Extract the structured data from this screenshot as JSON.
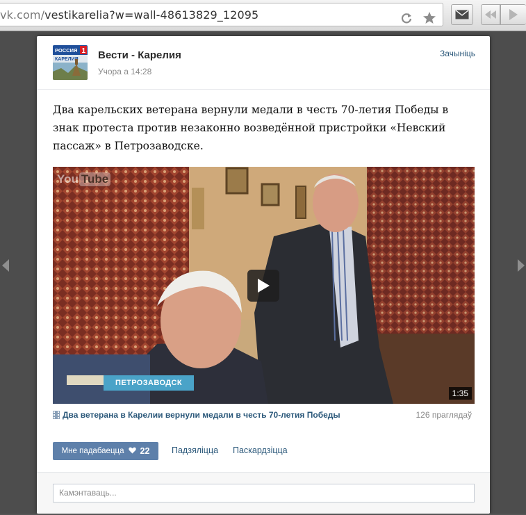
{
  "browser": {
    "url_host": "vk.com/",
    "url_path": "vestikarelia?w=wall-48613829_12095",
    "icons": [
      "reload-icon",
      "star-icon",
      "mail-icon",
      "back-icon",
      "forward-icon"
    ]
  },
  "post": {
    "author": "Вести - Карелия",
    "time": "Учора а 14:28",
    "close_label": "Зачыніць",
    "avatar_label": {
      "top": "РОССИЯ",
      "num": "1",
      "bottom": "КАРЕЛИЯ"
    },
    "text": "Два карельских ветерана вернули медали в честь 70-летия Победы в знак протеста против незаконно возведённой пристройки «Невский пассаж» в Петрозаводске.",
    "video": {
      "logo_you": "You",
      "logo_tube": "Tube",
      "location_caption": "ПЕТРОЗАВОДСК",
      "duration": "1:35",
      "title": "Два ветерана в Карелии вернули медали в честь 70-летия Победы",
      "views": "126 праглядаў"
    },
    "actions": {
      "like_label": "Мне падабаецца",
      "like_count": "22",
      "share_label": "Падзяліцца",
      "complain_label": "Паскардзіцца"
    },
    "comment_placeholder": "Камэнтаваць..."
  },
  "colors": {
    "link": "#2b587a",
    "like_button": "#5e80aa",
    "overlay": "#4d4d4d"
  }
}
